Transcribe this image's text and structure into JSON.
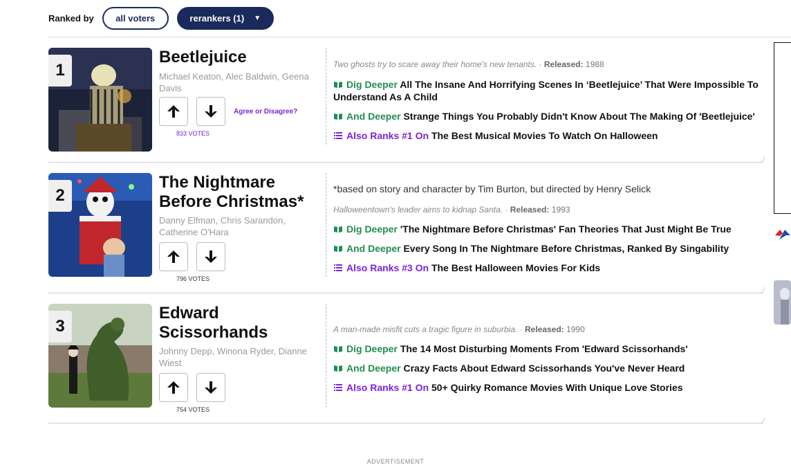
{
  "header": {
    "ranked_by_label": "Ranked by",
    "filter_all": "all voters",
    "filter_rerankers": "rerankers (1)",
    "caret": "▼"
  },
  "items": [
    {
      "rank": "1",
      "title": "Beetlejuice",
      "cast": "Michael Keaton, Alec Baldwin, Geena Davis",
      "votes": "833 VOTES",
      "agree": "Agree or Disagree?",
      "note": "",
      "description": "Two ghosts try to scare away their home's new tenants.",
      "released_label": "Released:",
      "year": "1988",
      "links": [
        {
          "label": "Dig Deeper",
          "text": "All The Insane And Horrifying Scenes In ‘Beetlejuice’ That Were Impossible To Understand As A Child"
        },
        {
          "label": "And Deeper",
          "text": "Strange Things You Probably Didn't Know About The Making Of 'Beetlejuice'"
        },
        {
          "label": "Also Ranks #1 On",
          "text": "The Best Musical Movies To Watch On Halloween"
        }
      ]
    },
    {
      "rank": "2",
      "title": "The Nightmare Before Christmas*",
      "cast": "Danny Elfman, Chris Sarandon, Catherine O'Hara",
      "votes": "796 VOTES",
      "note": "*based on story and character by Tim Burton, but directed by Henry Selick",
      "description": "Halloweentown's leader aims to kidnap Santa.",
      "released_label": "Released:",
      "year": "1993",
      "links": [
        {
          "label": "Dig Deeper",
          "text": "'The Nightmare Before Christmas' Fan Theories That Just Might Be True"
        },
        {
          "label": "And Deeper",
          "text": "Every Song In The Nightmare Before Christmas, Ranked By Singability"
        },
        {
          "label": "Also Ranks #3 On",
          "text": "The Best Halloween Movies For Kids"
        }
      ]
    },
    {
      "rank": "3",
      "title": "Edward Scissorhands",
      "cast": "Johnny Depp, Winona Ryder, Dianne Wiest",
      "votes": "754 VOTES",
      "note": "",
      "description": "A man-made misfit cuts a tragic figure in suburbia.",
      "released_label": "Released:",
      "year": "1990",
      "links": [
        {
          "label": "Dig Deeper",
          "text": "The 14 Most Disturbing Moments From 'Edward Scissorhands'"
        },
        {
          "label": "And Deeper",
          "text": "Crazy Facts About Edward Scissorhands You've Never Heard"
        },
        {
          "label": "Also Ranks #1 On",
          "text": "50+ Quirky Romance Movies With Unique Love Stories"
        }
      ]
    }
  ],
  "footer": {
    "advertisement": "ADVERTISEMENT"
  },
  "colors": {
    "navy": "#1b2a5c",
    "green": "#1f8f4e",
    "purple": "#7a22d6"
  }
}
